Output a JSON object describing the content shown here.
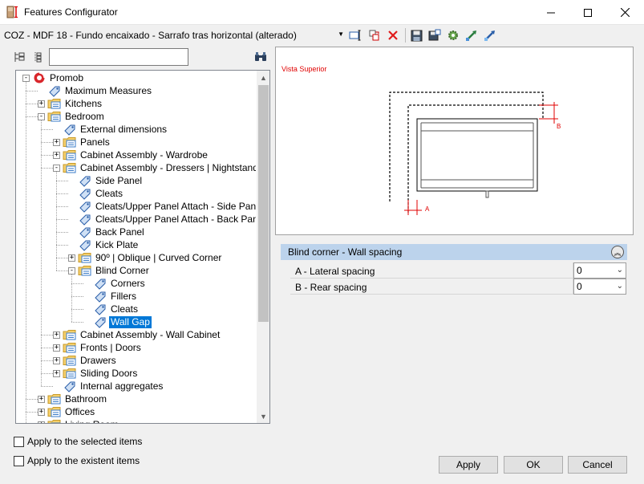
{
  "window": {
    "title": "Features Configurator",
    "min_symbol": "—",
    "max_symbol": "☐",
    "close_symbol": "✕"
  },
  "toolbar": {
    "configuration_value": "COZ - MDF 18 - Fundo encaixado - Sarrafo tras horizontal (alterado)",
    "icons": [
      "rename-icon",
      "export-icon",
      "delete-icon",
      "save-icon",
      "save-as-icon",
      "settings-icon",
      "import-icon",
      "export-arrow-icon"
    ],
    "delete_color": "#e01b1b"
  },
  "tree_search": {
    "value": ""
  },
  "tree": {
    "nodes": [
      {
        "label": "Promob",
        "icon": "root-icon",
        "level": 0,
        "expander": "minus"
      },
      {
        "label": "Maximum Measures",
        "icon": "tag-icon",
        "level": 1,
        "expander": ""
      },
      {
        "label": "Kitchens",
        "icon": "folder-icon",
        "level": 1,
        "expander": "plus"
      },
      {
        "label": "Bedroom",
        "icon": "folder-icon",
        "level": 1,
        "expander": "minus"
      },
      {
        "label": "External dimensions",
        "icon": "tag-icon",
        "level": 2,
        "expander": ""
      },
      {
        "label": "Panels",
        "icon": "folder-icon",
        "level": 2,
        "expander": "plus"
      },
      {
        "label": "Cabinet Assembly - Wardrobe",
        "icon": "folder-icon",
        "level": 2,
        "expander": "plus"
      },
      {
        "label": "Cabinet Assembly - Dressers | Nightstands",
        "icon": "folder-icon",
        "level": 2,
        "expander": "minus"
      },
      {
        "label": "Side Panel",
        "icon": "tag-icon",
        "level": 3,
        "expander": ""
      },
      {
        "label": "Cleats",
        "icon": "tag-icon",
        "level": 3,
        "expander": ""
      },
      {
        "label": "Cleats/Upper Panel Attach - Side Panel",
        "icon": "tag-icon",
        "level": 3,
        "expander": ""
      },
      {
        "label": "Cleats/Upper Panel Attach - Back Panel",
        "icon": "tag-icon",
        "level": 3,
        "expander": ""
      },
      {
        "label": "Back Panel",
        "icon": "tag-icon",
        "level": 3,
        "expander": ""
      },
      {
        "label": "Kick Plate",
        "icon": "tag-icon",
        "level": 3,
        "expander": ""
      },
      {
        "label": "90º | Oblique | Curved Corner",
        "icon": "folder-icon",
        "level": 3,
        "expander": "plus"
      },
      {
        "label": "Blind Corner",
        "icon": "folder-icon",
        "level": 3,
        "expander": "minus"
      },
      {
        "label": "Corners",
        "icon": "tag-icon",
        "level": 4,
        "expander": ""
      },
      {
        "label": "Fillers",
        "icon": "tag-icon",
        "level": 4,
        "expander": ""
      },
      {
        "label": "Cleats",
        "icon": "tag-icon",
        "level": 4,
        "expander": ""
      },
      {
        "label": "Wall Gap",
        "icon": "tag-icon",
        "level": 4,
        "expander": "",
        "selected": true
      },
      {
        "label": "Cabinet Assembly - Wall Cabinet",
        "icon": "folder-icon",
        "level": 2,
        "expander": "plus"
      },
      {
        "label": "Fronts | Doors",
        "icon": "folder-icon",
        "level": 2,
        "expander": "plus"
      },
      {
        "label": "Drawers",
        "icon": "folder-icon",
        "level": 2,
        "expander": "plus"
      },
      {
        "label": "Sliding Doors",
        "icon": "folder-icon",
        "level": 2,
        "expander": "plus"
      },
      {
        "label": "Internal aggregates",
        "icon": "tag-icon",
        "level": 2,
        "expander": ""
      },
      {
        "label": "Bathroom",
        "icon": "folder-icon",
        "level": 1,
        "expander": "plus"
      },
      {
        "label": "Offices",
        "icon": "folder-icon",
        "level": 1,
        "expander": "plus"
      },
      {
        "label": "Living Room",
        "icon": "folder-icon",
        "level": 1,
        "expander": "plus"
      }
    ],
    "selection_color": "#0078d7"
  },
  "options": {
    "apply_selected_label": "Apply to the selected items",
    "apply_existent_label": "Apply to the existent items"
  },
  "preview": {
    "title": "Vista Superior",
    "label_a": "A",
    "label_b": "B",
    "annotation_color": "#e00000"
  },
  "properties": {
    "section_title": "Blind corner - Wall spacing",
    "rows": [
      {
        "label": "A - Lateral spacing",
        "value": "0"
      },
      {
        "label": "B - Rear spacing",
        "value": "0"
      }
    ]
  },
  "buttons": {
    "apply": "Apply",
    "ok": "OK",
    "cancel": "Cancel"
  }
}
